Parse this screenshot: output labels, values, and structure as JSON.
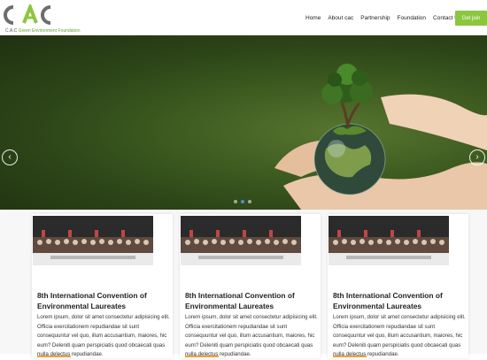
{
  "header": {
    "logo_text": "CAC",
    "logo_caption_prefix": "C.A.C",
    "logo_caption_suffix": "Green Environment Foundation",
    "nav": [
      "Home",
      "About cac",
      "Partnership",
      "Foundation",
      "Contact Us"
    ],
    "join_label": "Get join",
    "accent_color": "#8cc63f"
  },
  "hero": {
    "prev_icon": "chevron-left-icon",
    "next_icon": "chevron-right-icon",
    "slides_count": 3,
    "active_slide": 2
  },
  "cards": [
    {
      "title": "8th International Convention of Environmental Laureates",
      "text": "Lorem ipsum, dolor sit amet consectetur adipisicing elit. Officia exercitationem repudiandae sit sunt consequuntur vel quo, illum accusantium, maiores, hic eum? Deleniti quam perspiciatis quod obcaecati quas nulla delectus repudiandae."
    },
    {
      "title": "8th International Convention of Environmental Laureates",
      "text": "Lorem ipsum, dolor sit amet consectetur adipisicing elit. Officia exercitationem repudiandae sit sunt consequuntur vel quo, illum accusantium, maiores, hic eum? Deleniti quam perspiciatis quod obcaecati quas nulla delectus repudiandae."
    },
    {
      "title": "8th International Convention of Environmental Laureates",
      "text": "Lorem ipsum, dolor sit amet consectetur adipisicing elit. Officia exercitationem repudiandae sit sunt consequuntur vel quo, illum accusantium, maiores, hic eum? Deleniti quam perspiciatis quod obcaecati quas nulla delectus repudiandae."
    }
  ]
}
